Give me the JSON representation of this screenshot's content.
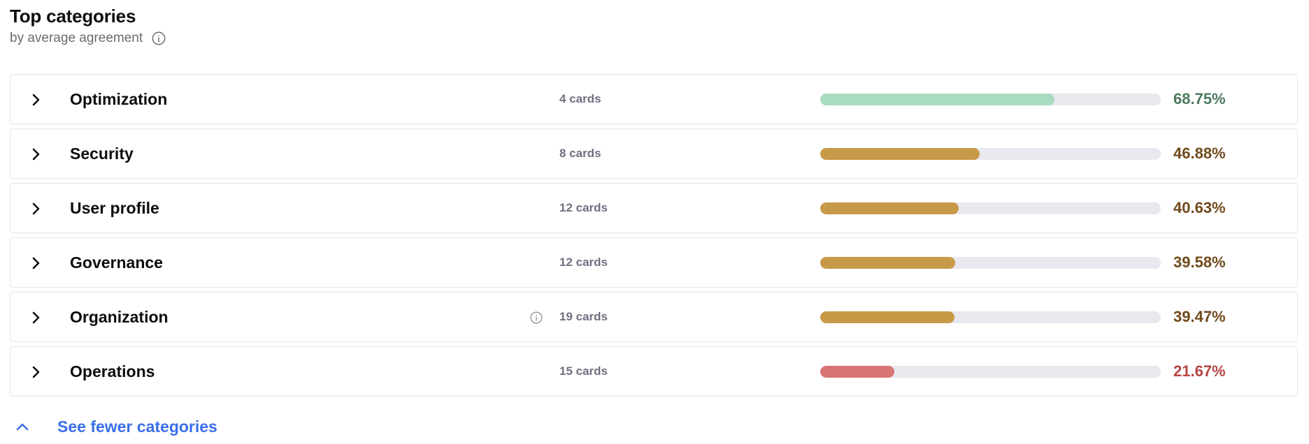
{
  "header": {
    "title": "Top categories",
    "subtitle": "by average agreement"
  },
  "colors": {
    "high": "#a8dbbf",
    "high_text": "#4b7a5c",
    "mid": "#c79a48",
    "mid_text": "#704a1c",
    "low": "#d97474",
    "low_text": "#b74545",
    "track": "#e8e8ee",
    "link": "#3a6fe8"
  },
  "categories": [
    {
      "name": "Optimization",
      "cards": "4 cards",
      "percent_label": "68.75%",
      "percent": 68.75,
      "level": "high",
      "has_info": false
    },
    {
      "name": "Security",
      "cards": "8 cards",
      "percent_label": "46.88%",
      "percent": 46.88,
      "level": "mid",
      "has_info": false
    },
    {
      "name": "User profile",
      "cards": "12 cards",
      "percent_label": "40.63%",
      "percent": 40.63,
      "level": "mid",
      "has_info": false
    },
    {
      "name": "Governance",
      "cards": "12 cards",
      "percent_label": "39.58%",
      "percent": 39.58,
      "level": "mid",
      "has_info": false
    },
    {
      "name": "Organization",
      "cards": "19 cards",
      "percent_label": "39.47%",
      "percent": 39.47,
      "level": "mid",
      "has_info": true
    },
    {
      "name": "Operations",
      "cards": "15 cards",
      "percent_label": "21.67%",
      "percent": 21.67,
      "level": "low",
      "has_info": false
    }
  ],
  "footer": {
    "label": "See fewer categories",
    "icon": "chevron-up-icon"
  }
}
